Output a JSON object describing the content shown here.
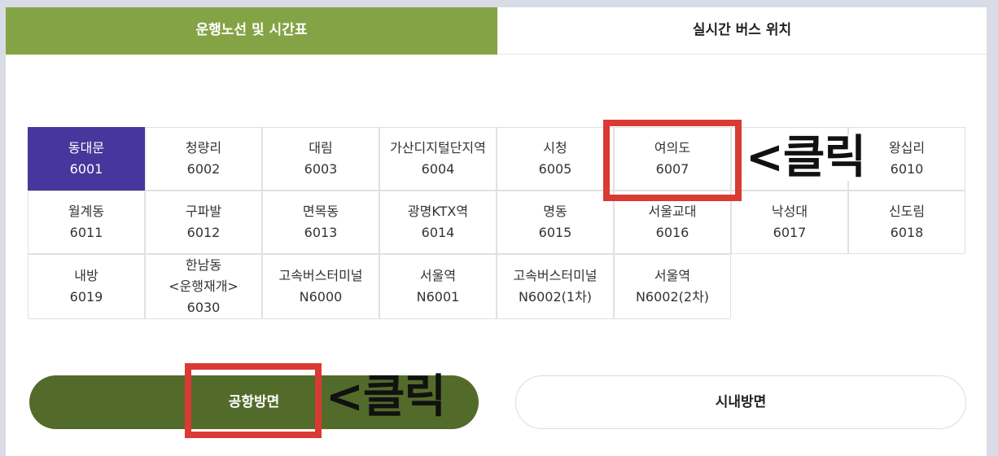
{
  "tabs": [
    {
      "label": "운행노선 및 시간표",
      "active": true
    },
    {
      "label": "실시간 버스 위치",
      "active": false
    }
  ],
  "routes": [
    {
      "name": "동대문",
      "number": "6001",
      "selected": true
    },
    {
      "name": "청량리",
      "number": "6002"
    },
    {
      "name": "대림",
      "number": "6003"
    },
    {
      "name": "가산디지털단지역",
      "number": "6004"
    },
    {
      "name": "시청",
      "number": "6005"
    },
    {
      "name": "여의도",
      "number": "6007"
    },
    {
      "name": "",
      "number": ""
    },
    {
      "name": "왕십리",
      "number": "6010"
    },
    {
      "name": "월계동",
      "number": "6011"
    },
    {
      "name": "구파발",
      "number": "6012"
    },
    {
      "name": "면목동",
      "number": "6013"
    },
    {
      "name": "광명KTX역",
      "number": "6014"
    },
    {
      "name": "명동",
      "number": "6015"
    },
    {
      "name": "서울교대",
      "number": "6016"
    },
    {
      "name": "낙성대",
      "number": "6017"
    },
    {
      "name": "신도림",
      "number": "6018"
    },
    {
      "name": "내방",
      "number": "6019"
    },
    {
      "name": "한남동",
      "note": "<운행재개>",
      "number": "6030"
    },
    {
      "name": "고속버스터미널",
      "number": "N6000"
    },
    {
      "name": "서울역",
      "number": "N6001"
    },
    {
      "name": "고속버스터미널",
      "number": "N6002(1차)"
    },
    {
      "name": "서울역",
      "number": "N6002(2차)"
    }
  ],
  "direction_buttons": {
    "airport": "공항방면",
    "city": "시내방면"
  },
  "annotations": {
    "click_1": "<클릭",
    "click_2": "<클릭"
  },
  "colors": {
    "active_tab": "#84a345",
    "selected_route": "#47369b",
    "airport_button": "#536b2a",
    "highlight": "#d93a34"
  }
}
